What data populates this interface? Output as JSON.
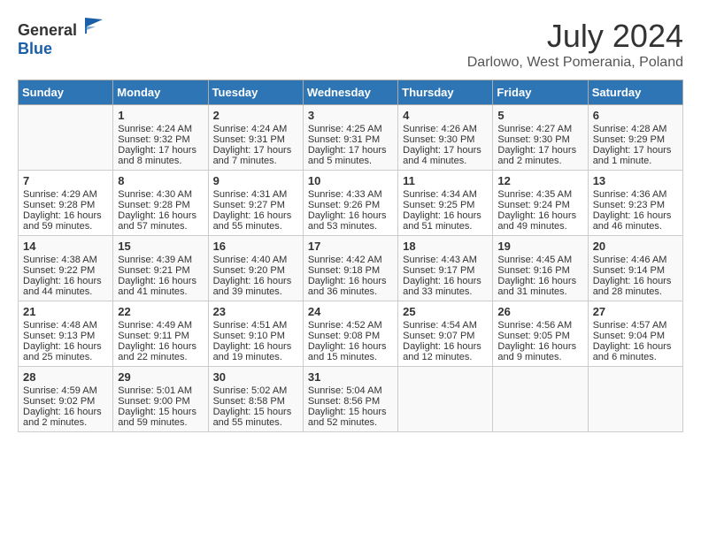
{
  "logo": {
    "text_general": "General",
    "text_blue": "Blue"
  },
  "title": "July 2024",
  "location": "Darlowo, West Pomerania, Poland",
  "headers": [
    "Sunday",
    "Monday",
    "Tuesday",
    "Wednesday",
    "Thursday",
    "Friday",
    "Saturday"
  ],
  "weeks": [
    [
      {
        "day": "",
        "content": ""
      },
      {
        "day": "1",
        "content": "Sunrise: 4:24 AM\nSunset: 9:32 PM\nDaylight: 17 hours\nand 8 minutes."
      },
      {
        "day": "2",
        "content": "Sunrise: 4:24 AM\nSunset: 9:31 PM\nDaylight: 17 hours\nand 7 minutes."
      },
      {
        "day": "3",
        "content": "Sunrise: 4:25 AM\nSunset: 9:31 PM\nDaylight: 17 hours\nand 5 minutes."
      },
      {
        "day": "4",
        "content": "Sunrise: 4:26 AM\nSunset: 9:30 PM\nDaylight: 17 hours\nand 4 minutes."
      },
      {
        "day": "5",
        "content": "Sunrise: 4:27 AM\nSunset: 9:30 PM\nDaylight: 17 hours\nand 2 minutes."
      },
      {
        "day": "6",
        "content": "Sunrise: 4:28 AM\nSunset: 9:29 PM\nDaylight: 17 hours\nand 1 minute."
      }
    ],
    [
      {
        "day": "7",
        "content": "Sunrise: 4:29 AM\nSunset: 9:28 PM\nDaylight: 16 hours\nand 59 minutes."
      },
      {
        "day": "8",
        "content": "Sunrise: 4:30 AM\nSunset: 9:28 PM\nDaylight: 16 hours\nand 57 minutes."
      },
      {
        "day": "9",
        "content": "Sunrise: 4:31 AM\nSunset: 9:27 PM\nDaylight: 16 hours\nand 55 minutes."
      },
      {
        "day": "10",
        "content": "Sunrise: 4:33 AM\nSunset: 9:26 PM\nDaylight: 16 hours\nand 53 minutes."
      },
      {
        "day": "11",
        "content": "Sunrise: 4:34 AM\nSunset: 9:25 PM\nDaylight: 16 hours\nand 51 minutes."
      },
      {
        "day": "12",
        "content": "Sunrise: 4:35 AM\nSunset: 9:24 PM\nDaylight: 16 hours\nand 49 minutes."
      },
      {
        "day": "13",
        "content": "Sunrise: 4:36 AM\nSunset: 9:23 PM\nDaylight: 16 hours\nand 46 minutes."
      }
    ],
    [
      {
        "day": "14",
        "content": "Sunrise: 4:38 AM\nSunset: 9:22 PM\nDaylight: 16 hours\nand 44 minutes."
      },
      {
        "day": "15",
        "content": "Sunrise: 4:39 AM\nSunset: 9:21 PM\nDaylight: 16 hours\nand 41 minutes."
      },
      {
        "day": "16",
        "content": "Sunrise: 4:40 AM\nSunset: 9:20 PM\nDaylight: 16 hours\nand 39 minutes."
      },
      {
        "day": "17",
        "content": "Sunrise: 4:42 AM\nSunset: 9:18 PM\nDaylight: 16 hours\nand 36 minutes."
      },
      {
        "day": "18",
        "content": "Sunrise: 4:43 AM\nSunset: 9:17 PM\nDaylight: 16 hours\nand 33 minutes."
      },
      {
        "day": "19",
        "content": "Sunrise: 4:45 AM\nSunset: 9:16 PM\nDaylight: 16 hours\nand 31 minutes."
      },
      {
        "day": "20",
        "content": "Sunrise: 4:46 AM\nSunset: 9:14 PM\nDaylight: 16 hours\nand 28 minutes."
      }
    ],
    [
      {
        "day": "21",
        "content": "Sunrise: 4:48 AM\nSunset: 9:13 PM\nDaylight: 16 hours\nand 25 minutes."
      },
      {
        "day": "22",
        "content": "Sunrise: 4:49 AM\nSunset: 9:11 PM\nDaylight: 16 hours\nand 22 minutes."
      },
      {
        "day": "23",
        "content": "Sunrise: 4:51 AM\nSunset: 9:10 PM\nDaylight: 16 hours\nand 19 minutes."
      },
      {
        "day": "24",
        "content": "Sunrise: 4:52 AM\nSunset: 9:08 PM\nDaylight: 16 hours\nand 15 minutes."
      },
      {
        "day": "25",
        "content": "Sunrise: 4:54 AM\nSunset: 9:07 PM\nDaylight: 16 hours\nand 12 minutes."
      },
      {
        "day": "26",
        "content": "Sunrise: 4:56 AM\nSunset: 9:05 PM\nDaylight: 16 hours\nand 9 minutes."
      },
      {
        "day": "27",
        "content": "Sunrise: 4:57 AM\nSunset: 9:04 PM\nDaylight: 16 hours\nand 6 minutes."
      }
    ],
    [
      {
        "day": "28",
        "content": "Sunrise: 4:59 AM\nSunset: 9:02 PM\nDaylight: 16 hours\nand 2 minutes."
      },
      {
        "day": "29",
        "content": "Sunrise: 5:01 AM\nSunset: 9:00 PM\nDaylight: 15 hours\nand 59 minutes."
      },
      {
        "day": "30",
        "content": "Sunrise: 5:02 AM\nSunset: 8:58 PM\nDaylight: 15 hours\nand 55 minutes."
      },
      {
        "day": "31",
        "content": "Sunrise: 5:04 AM\nSunset: 8:56 PM\nDaylight: 15 hours\nand 52 minutes."
      },
      {
        "day": "",
        "content": ""
      },
      {
        "day": "",
        "content": ""
      },
      {
        "day": "",
        "content": ""
      }
    ]
  ]
}
